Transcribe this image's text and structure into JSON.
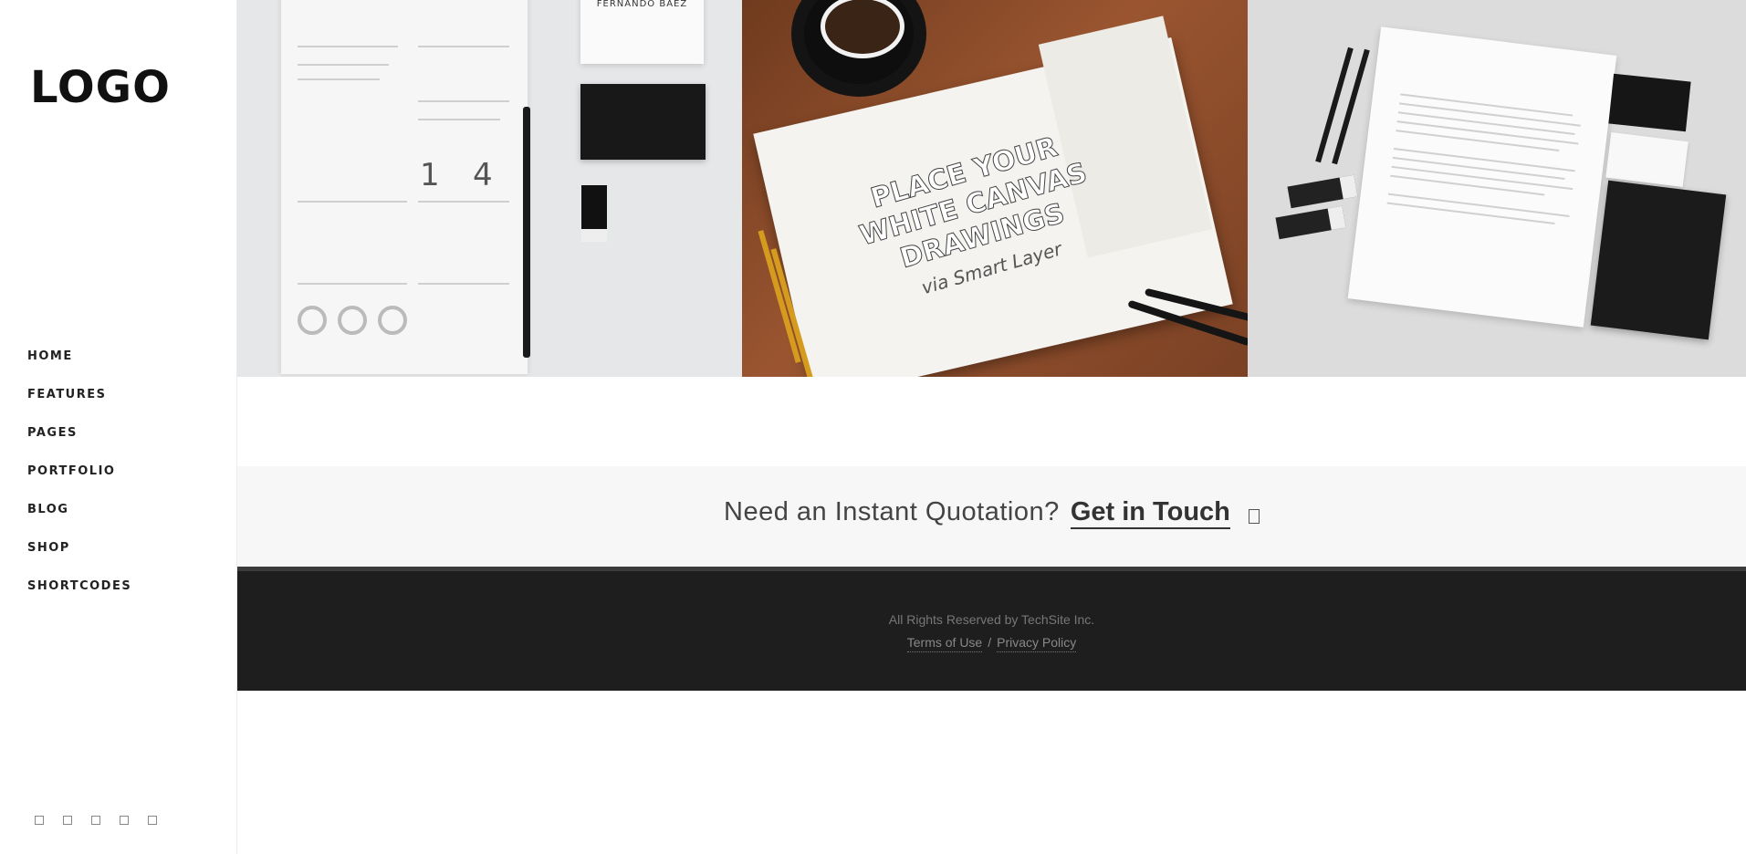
{
  "sidebar": {
    "logo": "LOGO",
    "nav": [
      "HOME",
      "FEATURES",
      "PAGES",
      "PORTFOLIO",
      "BLOG",
      "SHOP",
      "SHORTCODES"
    ],
    "social_icons": [
      "facebook-icon",
      "twitter-icon",
      "instagram-icon",
      "dribbble-icon",
      "pinterest-icon"
    ]
  },
  "gallery": {
    "tile_1": {
      "card_name": "FERNANDO BÁEZ",
      "number_a": "1",
      "number_b": "4"
    },
    "tile_2": {
      "sketch_line_1": "PLACE YOUR",
      "sketch_line_2": "WHITE CANVAS",
      "sketch_line_3": "DRAWINGS",
      "sketch_line_4": "via Smart Layer"
    },
    "tile_3": {}
  },
  "cta": {
    "text": "Need an Instant Quotation?",
    "link": "Get in Touch",
    "icon": "arrow-icon"
  },
  "footer": {
    "copyright": "All Rights Reserved by TechSite Inc.",
    "terms": "Terms of Use",
    "separator": "/",
    "privacy": "Privacy Policy"
  },
  "colors": {
    "footer_bg": "#1e1e1e",
    "cta_bg": "#f7f7f7",
    "text_dark": "#222222"
  }
}
